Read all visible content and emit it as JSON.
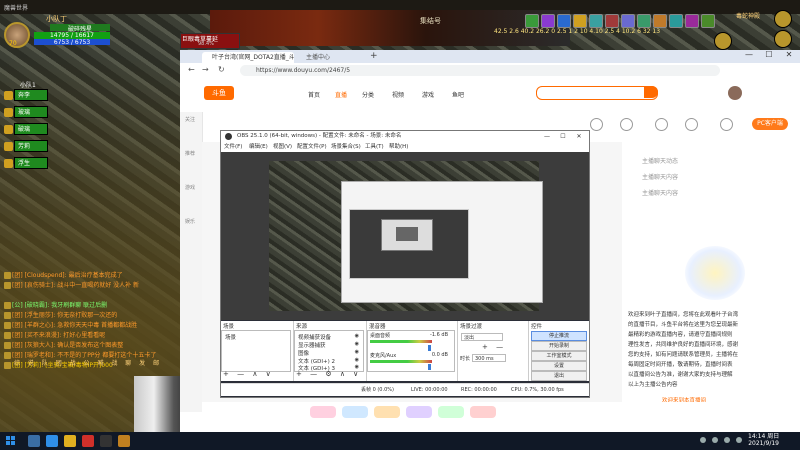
{
  "game": {
    "title_bar": "魔兽世界",
    "map_title": "集结号",
    "unit": {
      "name": "小队丁",
      "level": "70",
      "name_plate": "破碎残星",
      "hp": "14795 / 16617",
      "hp_right": "14795 / 16617",
      "mp": "6753 / 6753"
    },
    "target": {
      "name": "巨眼毒草蔓延",
      "sub": "98.4%"
    },
    "buff_timers": "42.5 2.6 40.2 26.2 0 2.5 1 2 10 4.10 2.5 4 10.2 6 32 13",
    "minimap_title": "毒蛇神殿",
    "party": {
      "header": "小队1",
      "members": [
        "奔李",
        "玻璃",
        "破璃",
        "芳莉",
        "浮生"
      ]
    },
    "chat": [
      {
        "text": "[团] [Cloudspend]: 最后治疗基本完成了",
        "color": "#ff9a2a"
      },
      {
        "text": "[团] [哀伤骑士]: 战斗中一直喝药就好 没人补 新",
        "color": "#ff9a2a"
      },
      {
        "text": "[公] [破晓霸]: 我牙刷群聊 联过后删",
        "color": "#7cff70"
      },
      {
        "text": "[团] [浮生丽莎]: 你无奈打败那一次还的",
        "color": "#ff9a2a"
      },
      {
        "text": "[团] [羊群之心]: 急救你天天中毒 首播都都战胜",
        "color": "#ff9a2a"
      },
      {
        "text": "[团] [买不来浪漫]: 打好心里看看呢",
        "color": "#ff9a2a"
      },
      {
        "text": "[团] [灰狼大人]: 确认是否发布这个图表整",
        "color": "#ff9a2a"
      },
      {
        "text": "[团] [瑞罗老和]: 不不是的了PP分 都要打这个十五卡了",
        "color": "#ff9a2a"
      },
      {
        "text": "[团] [芳莉]: [坐骑/宝箱/毒物IP开]000",
        "color": "#ffd000"
      }
    ],
    "chat_tabs": "综 说 队 团 战 公 喊 战 聊 发 邮"
  },
  "browser": {
    "tab1": "叶子台湾(官网_DOTA2直播_斗鱼直播",
    "tab2": "主播中心",
    "new_tab": "+",
    "url": "https://www.douyu.com/2467/5",
    "window_controls": [
      "—",
      "☐",
      "✕"
    ],
    "nav": [
      "←",
      "→",
      "↻"
    ]
  },
  "douyu": {
    "logo": "斗鱼",
    "nav_items": [
      "首页",
      "直播",
      "分类",
      "视频",
      "游戏",
      "鱼吧"
    ],
    "pc_button": "PC客户端",
    "left_nav": [
      "关注",
      "推荐",
      "游戏",
      "娱乐"
    ],
    "right_lines": [
      "主播聊天动态",
      "主播聊天内容",
      "主播聊天内容"
    ],
    "notice_lines": [
      "欢迎来到叶子直播间，您将在此观看叶子台湾",
      "的直播节目，斗鱼平台将在这里为您呈现最新",
      "最精彩的游戏直播内容，请遵守直播间规则",
      "理性发言，共同维护良好的直播间环境，感谢",
      "您的支持，如有问题请联系管理员，主播将在",
      "每周固定时间开播，敬请期待，直播时间表",
      "以直播间公告为准，谢谢大家的支持与理解",
      "以上为主播公告内容"
    ],
    "notice_footer": "欢迎来到本直播间"
  },
  "obs": {
    "title": "OBS 25.1.0 (64-bit, windows) - 配置文件: 未命名 - 场景: 未命名",
    "menus": [
      "文件(F)",
      "编辑(E)",
      "视图(V)",
      "配置文件(P)",
      "场景集合(S)",
      "工具(T)",
      "帮助(H)"
    ],
    "window_controls": [
      "—",
      "☐",
      "✕"
    ],
    "docks": {
      "scenes": {
        "title": "场景",
        "items": [
          "场景"
        ],
        "tools": "+ — ∧ ∨"
      },
      "sources": {
        "title": "来源",
        "items": [
          "视频捕获设备",
          "显示器捕获",
          "图像",
          "文本 (GDI+) 2",
          "文本 (GDI+) 3"
        ],
        "tools": "+ — ⚙ ∧ ∨"
      },
      "mixer": {
        "title": "混音器",
        "channels": [
          {
            "name": "桌面音频",
            "db": "-1.6 dB"
          },
          {
            "name": "麦克风/Aux",
            "db": "0.0 dB"
          }
        ]
      },
      "transitions": {
        "title": "场景过渡",
        "type": "淡出",
        "duration_label": "时长",
        "duration": "300 ms",
        "tools": "+ —"
      },
      "controls": {
        "title": "控件",
        "buttons": [
          "停止推流",
          "开始录制",
          "工作室模式",
          "设置",
          "退出"
        ]
      }
    },
    "status": {
      "live": "LIVE: 00:00:00",
      "rec": "REC: 00:00:00",
      "cpu": "CPU: 0.7%, 30.00 fps",
      "dropped": "丢帧 0 (0.0%)"
    }
  },
  "taskbar": {
    "time": "14:14 周日",
    "date": "2021/9/19"
  }
}
